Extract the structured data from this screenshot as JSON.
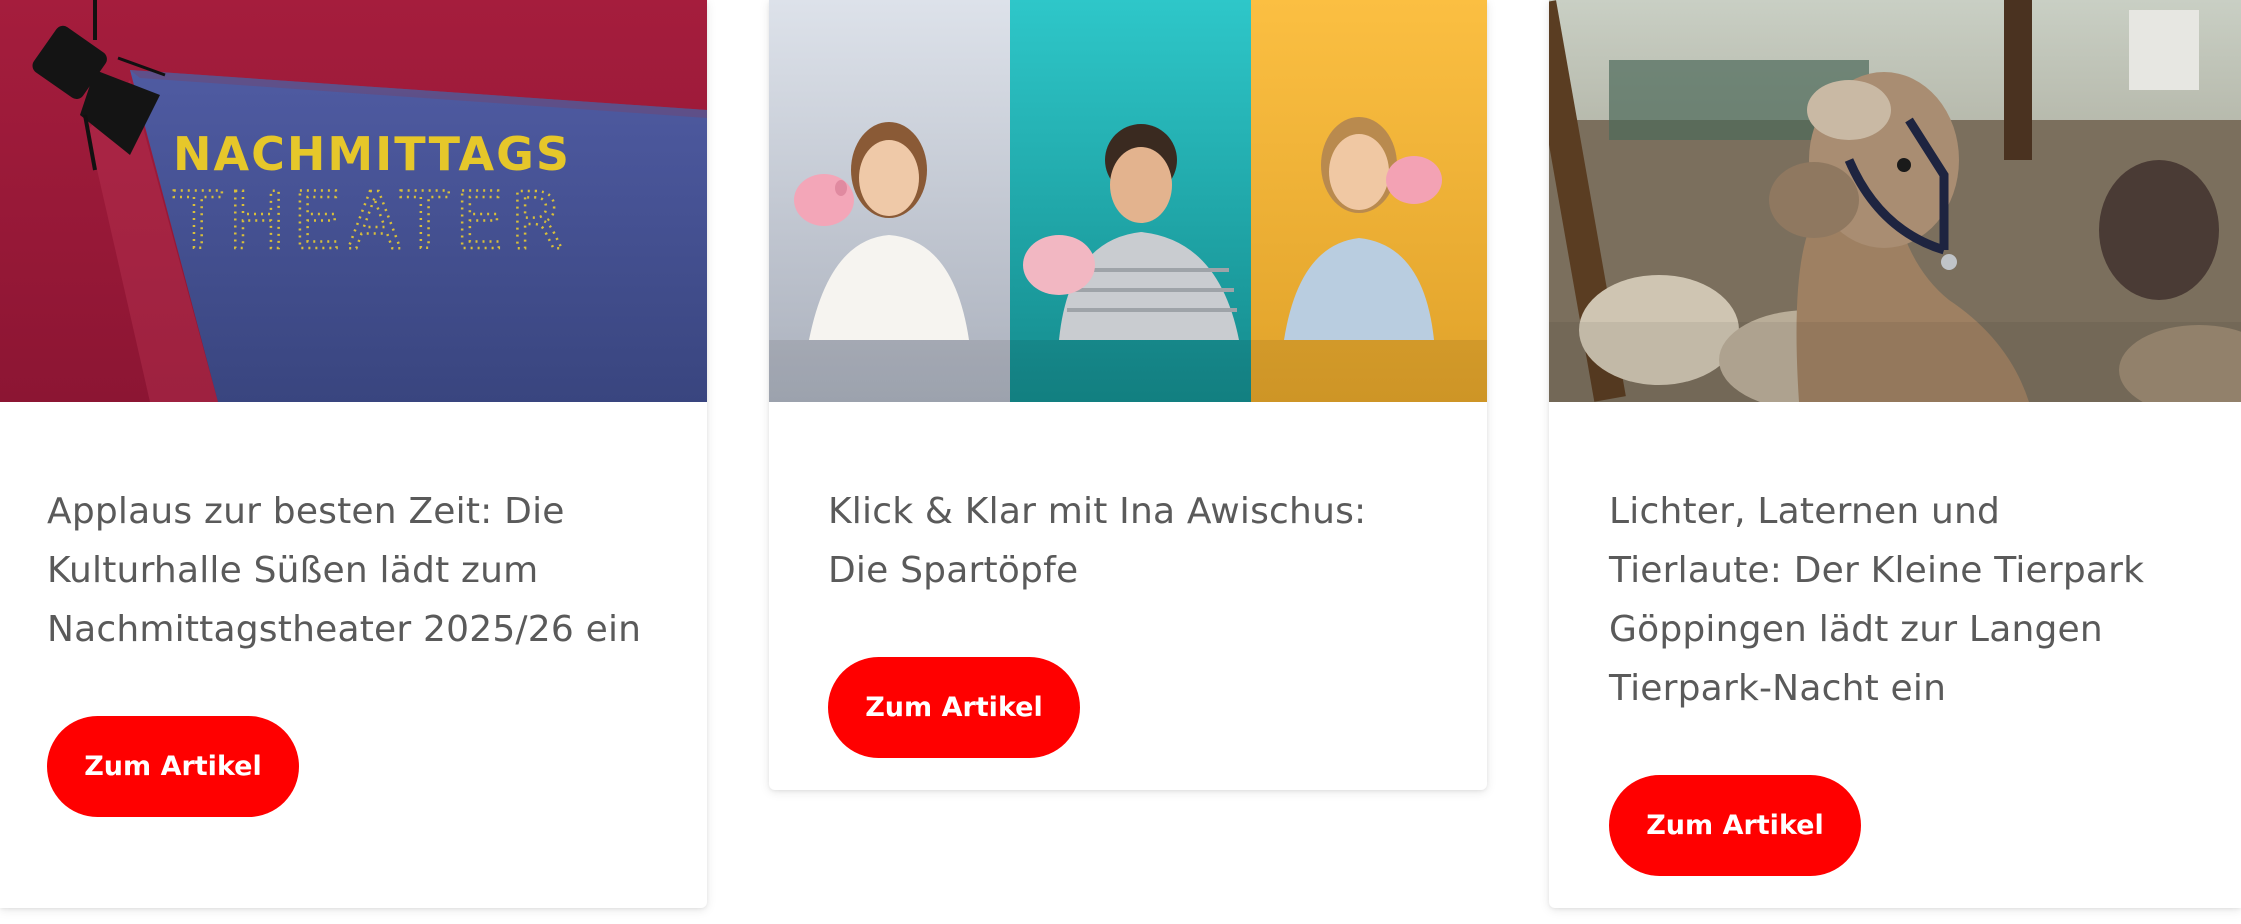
{
  "cards": [
    {
      "image_title_line1": "NACHMITTAGS",
      "image_title_line2": "THEATER",
      "title": "Applaus zur besten Zeit: Die Kulturhalle Süßen lädt zum Nachmittagstheater 2025/26 ein",
      "button_label": "Zum Artikel"
    },
    {
      "title": "Klick & Klar mit Ina Awischus: Die Spartöpfe",
      "button_label": "Zum Artikel"
    },
    {
      "title": "Lichter, Laternen und Tierlaute: Der Kleine Tierpark Göppingen lädt zur Langen Tierpark-Nacht ein",
      "button_label": "Zum Artikel"
    }
  ],
  "colors": {
    "button": "#ff0000",
    "title_text": "#5a5a5a",
    "theater_red": "#a31d3c",
    "theater_blue": "#4a559a",
    "theater_yellow": "#e6c72a",
    "panel_grey": "#d8dde6",
    "panel_teal": "#1aa9ab",
    "panel_orange": "#f5b53a"
  }
}
